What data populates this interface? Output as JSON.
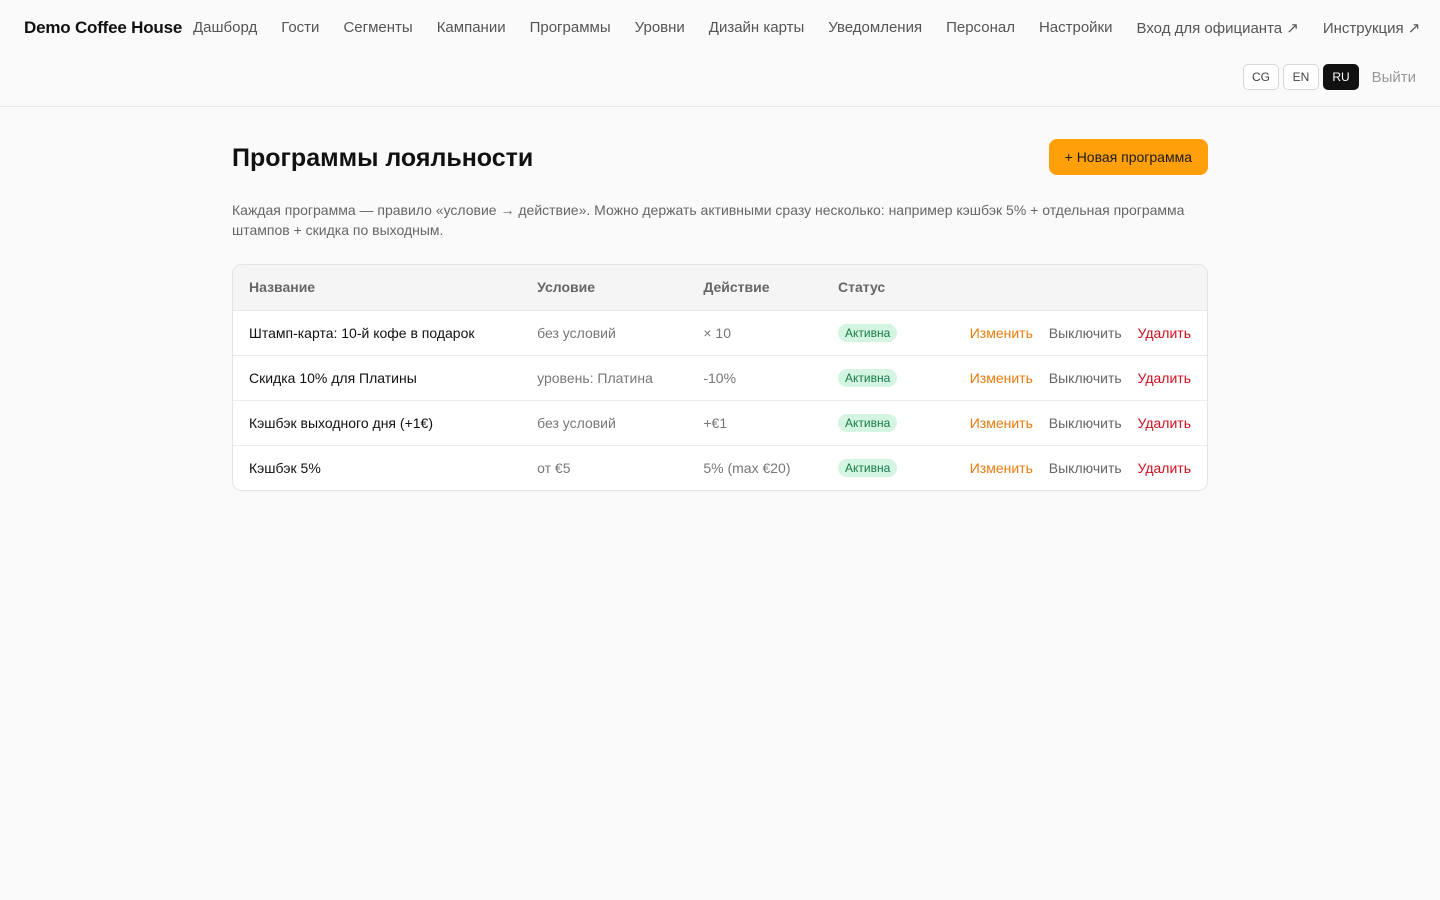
{
  "header": {
    "brand": "Demo Coffee House",
    "nav": [
      "Дашборд",
      "Гости",
      "Сегменты",
      "Кампании",
      "Программы",
      "Уровни",
      "Дизайн карты",
      "Уведомления",
      "Персонал",
      "Настройки",
      "Вход для официанта ↗",
      "Инструкция ↗"
    ],
    "languages": [
      "CG",
      "EN",
      "RU"
    ],
    "active_language": "RU",
    "logout": "Выйти"
  },
  "page": {
    "title": "Программы лояльности",
    "new_button": "+ Новая программа",
    "description": "Каждая программа — правило «условие → действие». Можно держать активными сразу несколько: например кэшбэк 5% + отдельная программа штампов + скидка по выходным."
  },
  "table": {
    "columns": [
      "Название",
      "Условие",
      "Действие",
      "Статус"
    ],
    "rows": [
      {
        "name": "Штамп-карта: 10-й кофе в подарок",
        "condition": "без условий",
        "action": "× 10",
        "status": "Активна"
      },
      {
        "name": "Скидка 10% для Платины",
        "condition": "уровень: Платина",
        "action": "-10%",
        "status": "Активна"
      },
      {
        "name": "Кэшбэк выходного дня (+1€)",
        "condition": "без условий",
        "action": "+€1",
        "status": "Активна"
      },
      {
        "name": "Кэшбэк 5%",
        "condition": "от €5",
        "action": "5% (max €20)",
        "status": "Активна"
      }
    ],
    "row_actions": {
      "edit": "Изменить",
      "toggle": "Выключить",
      "delete": "Удалить"
    }
  },
  "colors": {
    "accent": "#ff9f0a",
    "edit": "#e87b0c",
    "delete": "#d0101f",
    "badge_bg": "#d5f5e3",
    "badge_text": "#177a45"
  }
}
